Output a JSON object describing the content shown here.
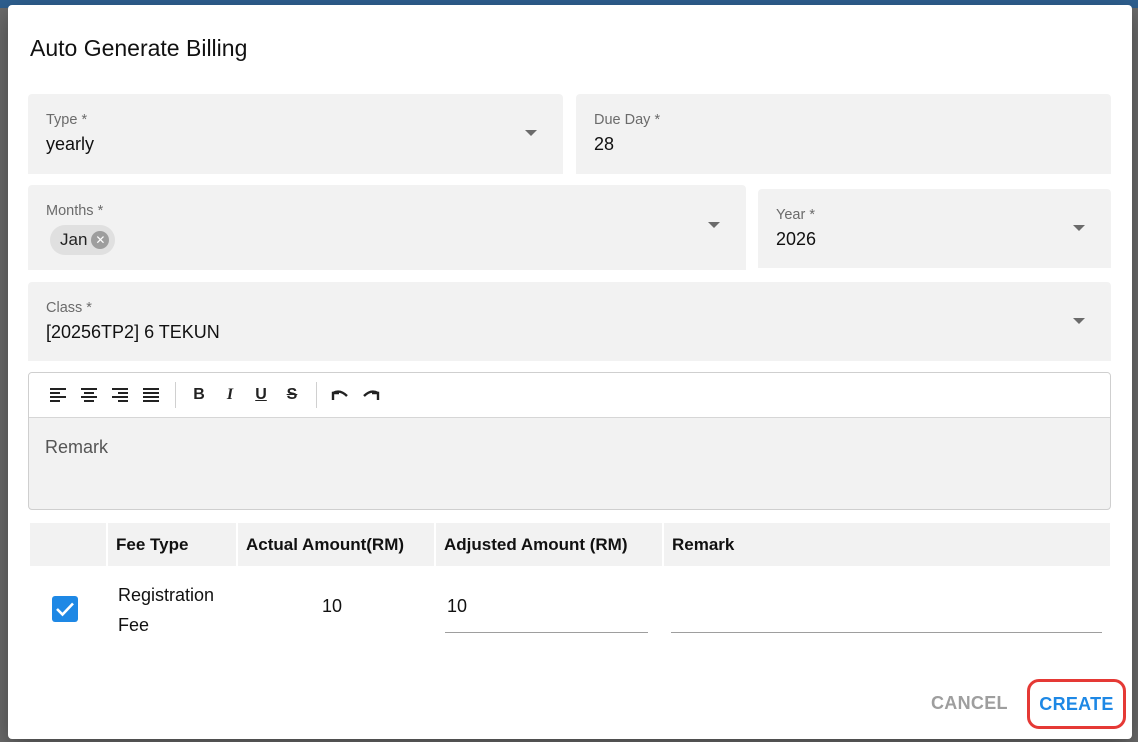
{
  "dialog": {
    "title": "Auto Generate Billing",
    "fields": {
      "type": {
        "label": "Type *",
        "value": "yearly"
      },
      "due_day": {
        "label": "Due Day *",
        "value": "28"
      },
      "months": {
        "label": "Months *",
        "chips": [
          "Jan"
        ]
      },
      "year": {
        "label": "Year *",
        "value": "2026"
      },
      "class": {
        "label": "Class *",
        "value": "[20256TP2] 6 TEKUN"
      }
    },
    "editor": {
      "placeholder": "Remark",
      "toolbar": [
        "align-left-icon",
        "align-center-icon",
        "align-right-icon",
        "align-justify-icon",
        "bold-icon",
        "italic-icon",
        "underline-icon",
        "strikethrough-icon",
        "undo-icon",
        "redo-icon"
      ]
    },
    "table": {
      "headers": [
        "Fee Type",
        "Actual Amount(RM)",
        "Adjusted Amount (RM)",
        "Remark"
      ],
      "rows": [
        {
          "checked": true,
          "fee_type": "Registration Fee",
          "actual_amount": "10",
          "adjusted_amount": "10",
          "remark": ""
        }
      ]
    },
    "actions": {
      "cancel": "CANCEL",
      "create": "CREATE"
    }
  },
  "colors": {
    "accent": "#1e88e5",
    "highlight": "#e53935",
    "field_bg": "#f2f2f2"
  }
}
